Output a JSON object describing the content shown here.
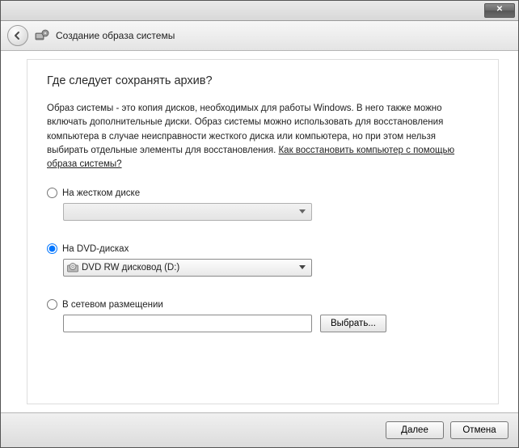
{
  "titlebar": {
    "close_label": "✕"
  },
  "header": {
    "title": "Создание образа системы"
  },
  "main": {
    "heading": "Где следует сохранять архив?",
    "description_pre": "Образ системы - это копия дисков, необходимых для работы Windows. В него также можно включать дополнительные диски. Образ системы можно использовать для восстановления компьютера в случае неисправности жесткого диска или компьютера, но при этом нельзя выбирать отдельные элементы для восстановления. ",
    "description_link": "Как восстановить компьютер с помощью образа системы?",
    "options": {
      "hdd": {
        "label": "На жестком диске",
        "selected": ""
      },
      "dvd": {
        "label": "На DVD-дисках",
        "selected": "DVD RW дисковод (D:)"
      },
      "network": {
        "label": "В сетевом размещении",
        "value": "",
        "browse_label": "Выбрать..."
      },
      "selected": "dvd"
    }
  },
  "footer": {
    "next_label": "Далее",
    "cancel_label": "Отмена"
  }
}
